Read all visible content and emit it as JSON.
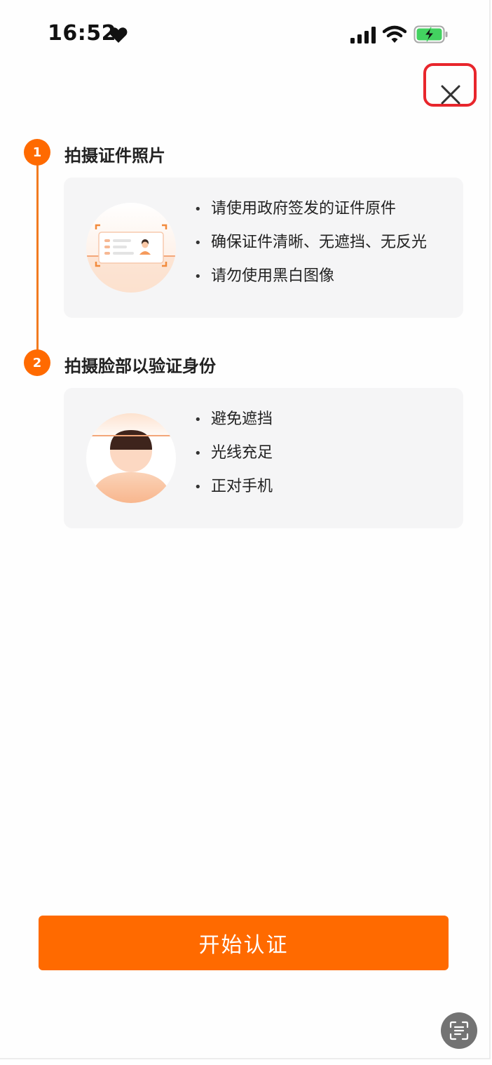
{
  "status_bar": {
    "time": "16:52",
    "icons": [
      "heart-icon",
      "signal-icon",
      "wifi-icon",
      "battery-charging-icon"
    ]
  },
  "colors": {
    "accent": "#ff6a00",
    "close_highlight": "#e8262c",
    "card_bg": "#f5f5f6"
  },
  "steps": [
    {
      "number": "1",
      "title": "拍摄证件照片",
      "tips": [
        "请使用政府签发的证件原件",
        "确保证件清晰、无遮挡、无反光",
        "请勿使用黑白图像"
      ]
    },
    {
      "number": "2",
      "title": "拍摄脸部以验证身份",
      "tips": [
        "避免遮挡",
        "光线充足",
        "正对手机"
      ]
    }
  ],
  "bullet": "•",
  "start_button": {
    "label": "开始认证"
  }
}
